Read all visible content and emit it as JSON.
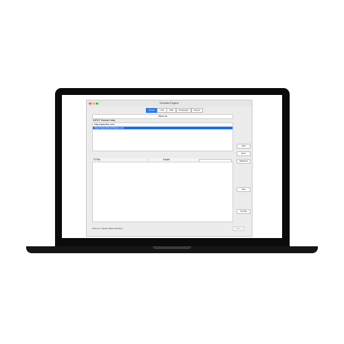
{
  "window": {
    "title": "Domain Engine"
  },
  "tabs": [
    {
      "label": "Domain",
      "active": true
    },
    {
      "label": "Links",
      "active": false
    },
    {
      "label": "ASIN",
      "active": false
    },
    {
      "label": "ShopifyApps",
      "active": false
    },
    {
      "label": "Reports",
      "active": false
    }
  ],
  "save_as": {
    "label": "Save as"
  },
  "input_section": {
    "label": "INPUT Domain links",
    "links": [
      {
        "text": "http://www.ibm.com",
        "selected": false
      },
      {
        "text": "http://www.thenorthface.com",
        "selected": true
      }
    ]
  },
  "side_buttons": {
    "add": "ADD",
    "edit": "EDIT",
    "remove": "REMOVE",
    "start": "Start",
    "pause": "PAUSE"
  },
  "results": {
    "total_label": "TOTAL",
    "separator": "|",
    "depth_label": "Depth",
    "depth_value": ""
  },
  "status": {
    "text": "Save as: ./please Select directory"
  },
  "footer": {
    "save_label": "Save"
  },
  "colors": {
    "accent": "#2a7be6",
    "selection": "#1f6fe6",
    "close": "#ff5f57",
    "minimize": "#febc2e",
    "zoom": "#28c840"
  }
}
